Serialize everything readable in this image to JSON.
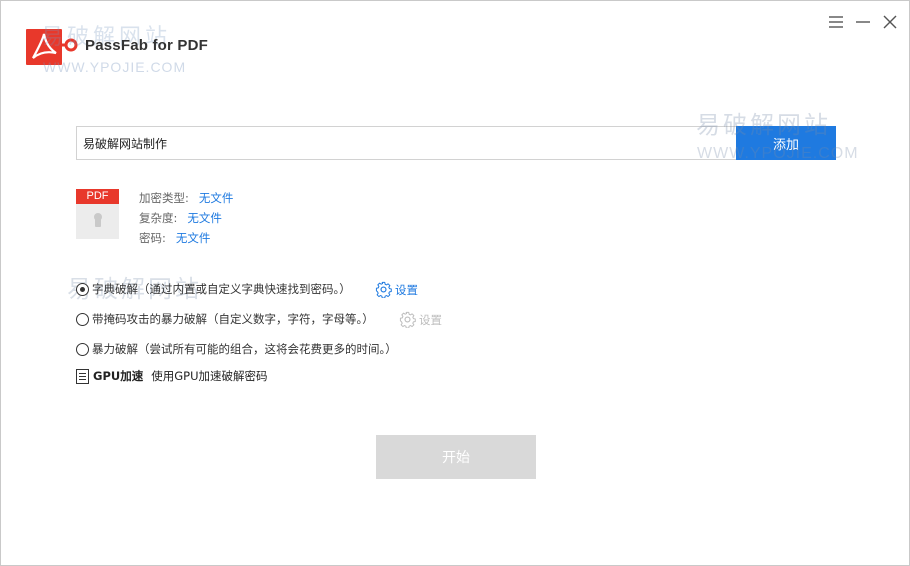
{
  "app": {
    "title": "PassFab for PDF",
    "brand_color": "#e8382b",
    "accent_color": "#1f7ae0"
  },
  "watermarks": {
    "cn": "易破解网站",
    "en": "WWW.YPOJIE.COM"
  },
  "window_controls": {
    "menu_icon": "hamburger-menu-icon",
    "minimize_icon": "minimize-icon",
    "close_icon": "close-icon"
  },
  "file": {
    "input_value": "易破解网站制作",
    "add_label": "添加"
  },
  "pdf_info": {
    "thumb_tag": "PDF",
    "encryption_type_label": "加密类型:",
    "encryption_type_value": "无文件",
    "complexity_label": "复杂度:",
    "complexity_value": "无文件",
    "password_label": "密码:",
    "password_value": "无文件"
  },
  "attack_modes": [
    {
      "label": "字典破解（通过内置或自定义字典快速找到密码。）",
      "selected": true,
      "settings_label": "设置",
      "settings_enabled": true
    },
    {
      "label": "带掩码攻击的暴力破解（自定义数字，字符，字母等。）",
      "selected": false,
      "settings_label": "设置",
      "settings_enabled": false
    },
    {
      "label": "暴力破解（尝试所有可能的组合，这将会花费更多的时间。）",
      "selected": false
    }
  ],
  "gpu": {
    "label": "GPU加速",
    "description": "使用GPU加速破解密码"
  },
  "start_label": "开始"
}
